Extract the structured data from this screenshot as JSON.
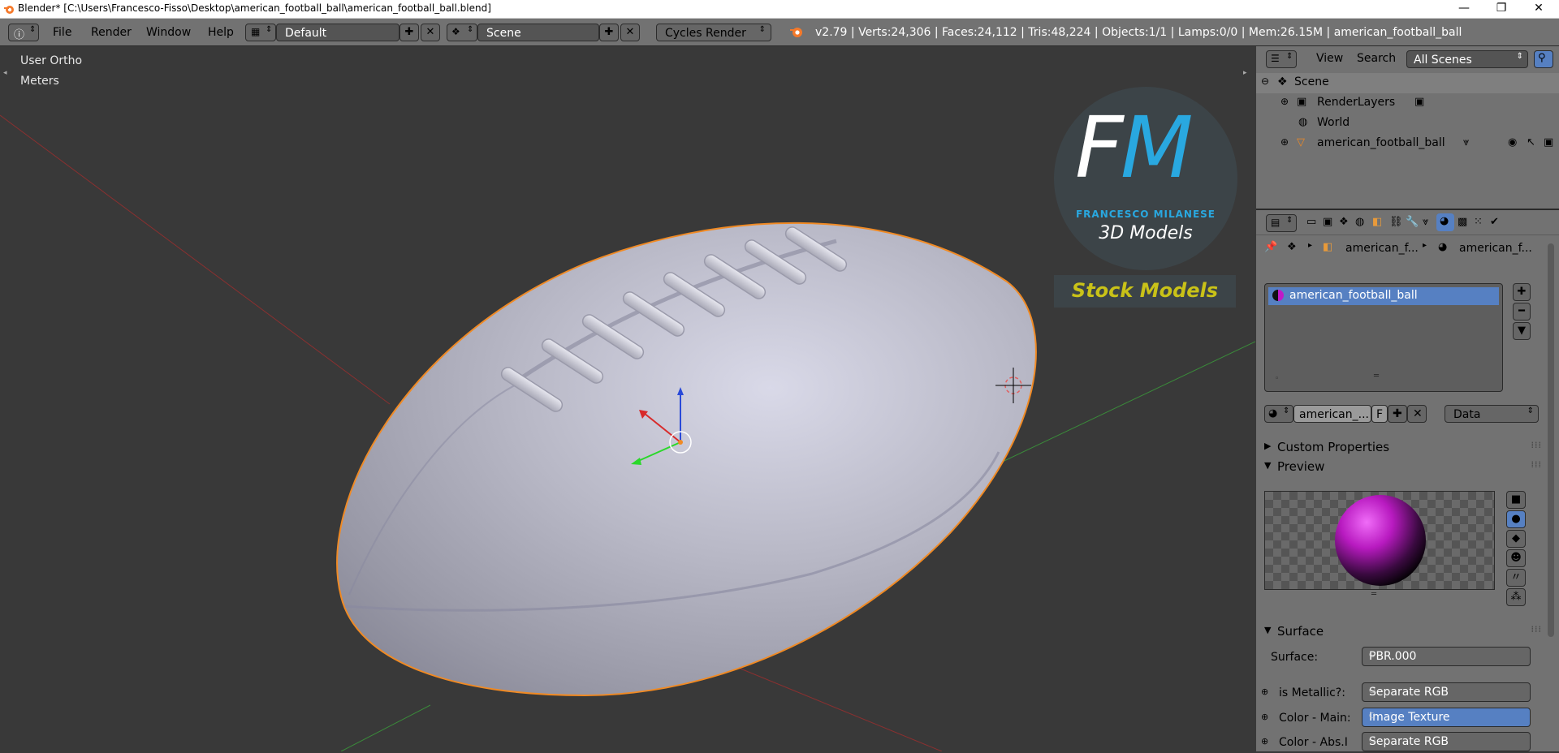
{
  "window": {
    "title": "Blender* [C:\\Users\\Francesco-Fisso\\Desktop\\american_football_ball\\american_football_ball.blend]",
    "minimize": "—",
    "maximize": "❐",
    "close": "✕"
  },
  "menubar": {
    "menus": [
      "File",
      "Render",
      "Window",
      "Help"
    ],
    "screen_layout": "Default",
    "scene": "Scene",
    "render_engine": "Cycles Render",
    "stats": "v2.79 | Verts:24,306 | Faces:24,112 | Tris:48,224 | Objects:1/1 | Lamps:0/0 | Mem:26.15M | american_football_ball"
  },
  "viewport": {
    "view_name": "User Ortho",
    "units": "Meters",
    "watermark": {
      "logo_letters": "FM",
      "author": "FRANCESCO MILANESE",
      "subtitle": "3D Models",
      "badge": "Stock Models"
    }
  },
  "outliner": {
    "header": {
      "view": "View",
      "search": "Search",
      "filter": "All Scenes"
    },
    "items": [
      {
        "label": "Scene"
      },
      {
        "label": "RenderLayers"
      },
      {
        "label": "World"
      },
      {
        "label": "american_football_ball"
      }
    ]
  },
  "properties": {
    "breadcrumb": [
      "american_f...",
      "american_f..."
    ],
    "material_slot": "american_football_ball",
    "material_name": "american_...",
    "fake_user": "F",
    "link_mode": "Data",
    "panels": {
      "custom_properties": "Custom Properties",
      "preview": "Preview",
      "surface": "Surface"
    },
    "surface_fields": [
      {
        "label": "Surface:",
        "value": "PBR.000"
      },
      {
        "label": "is Metallic?:",
        "value": "Separate RGB"
      },
      {
        "label": "Color - Main:",
        "value": "Image Texture"
      },
      {
        "label": "Color - Abs.I",
        "value": "Separate RGB"
      }
    ]
  },
  "colors": {
    "selected_blue": "#5680c2",
    "outline_orange": "#f08a24",
    "logo_blue": "#29a8e0",
    "badge_yellow": "#c9c218"
  }
}
